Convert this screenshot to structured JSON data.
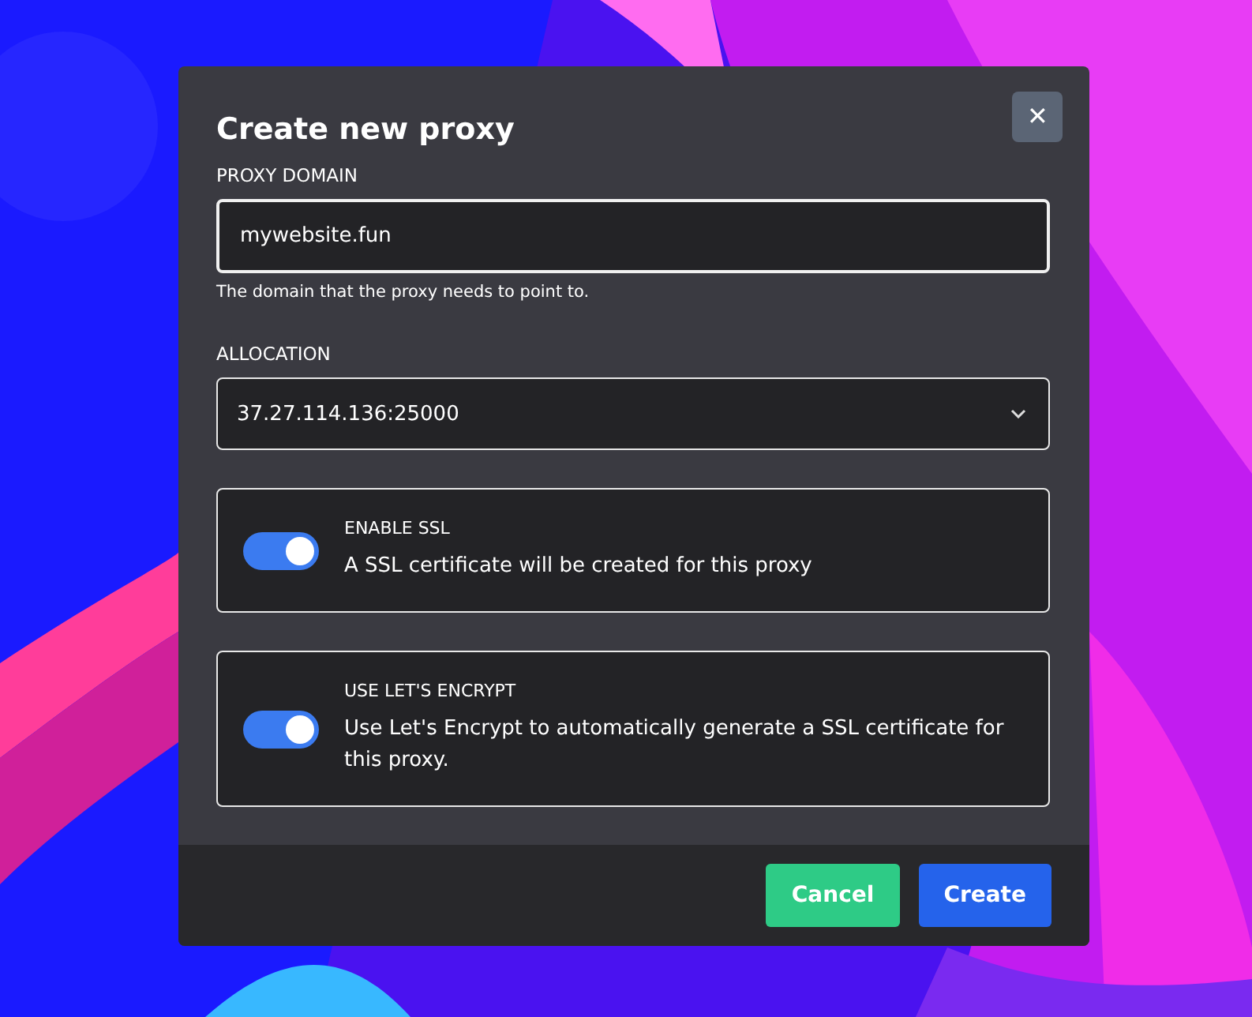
{
  "dialog": {
    "title": "Create new proxy",
    "close_label": "✕",
    "domain": {
      "label": "PROXY DOMAIN",
      "value": "mywebsite.fun",
      "help": "The domain that the proxy needs to point to."
    },
    "allocation": {
      "label": "ALLOCATION",
      "value": "37.27.114.136:25000"
    },
    "toggles": [
      {
        "label": "ENABLE SSL",
        "description": "A SSL certificate will be created for this proxy",
        "on": true
      },
      {
        "label": "USE LET'S ENCRYPT",
        "description": "Use Let's Encrypt to automatically generate a SSL certificate for this proxy.",
        "on": true
      }
    ],
    "buttons": [
      {
        "label": "Cancel",
        "kind": "secondary"
      },
      {
        "label": "Create",
        "kind": "primary"
      }
    ]
  }
}
